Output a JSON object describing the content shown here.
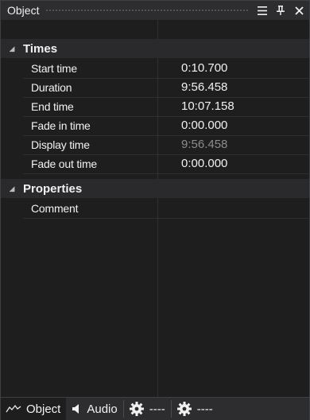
{
  "window": {
    "title": "Object",
    "buttons": {
      "menu": "☰",
      "pin": "pin-icon",
      "close": "✕"
    }
  },
  "categories": [
    {
      "label": "Times",
      "rows": [
        {
          "name": "Start time",
          "value": "0:10.700",
          "dim": false
        },
        {
          "name": "Duration",
          "value": "9:56.458",
          "dim": false
        },
        {
          "name": "End time",
          "value": "10:07.158",
          "dim": false
        },
        {
          "name": "Fade in time",
          "value": "0:00.000",
          "dim": false
        },
        {
          "name": "Display time",
          "value": "9:56.458",
          "dim": true
        },
        {
          "name": "Fade out time",
          "value": "0:00.000",
          "dim": false
        }
      ]
    },
    {
      "label": "Properties",
      "rows": [
        {
          "name": "Comment",
          "value": "",
          "dim": false
        }
      ]
    }
  ],
  "tabs": [
    {
      "label": "Object",
      "icon": "waveform-icon",
      "active": true
    },
    {
      "label": "Audio",
      "icon": "speaker-icon",
      "active": false
    },
    {
      "label": "----",
      "icon": "gear-icon",
      "active": false
    },
    {
      "label": "----",
      "icon": "gear-icon",
      "active": false
    }
  ],
  "colors": {
    "background": "#1e1e1e",
    "chrome": "#2d2d30",
    "text": "#f1f1f1",
    "dim_text": "#8c8c8c"
  }
}
